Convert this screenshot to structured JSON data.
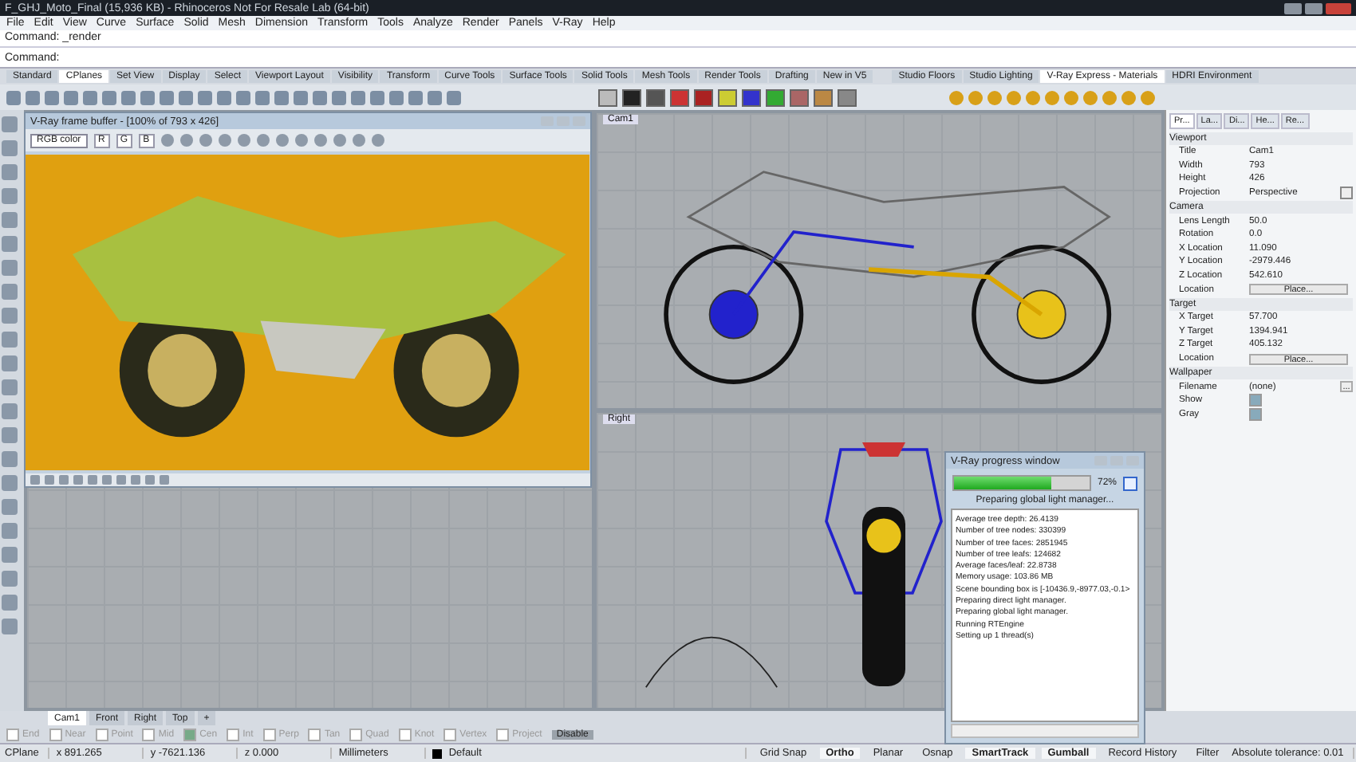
{
  "window": {
    "title": "F_GHJ_Moto_Final (15,936 KB) - Rhinoceros Not For Resale Lab (64-bit)"
  },
  "menu": [
    "File",
    "Edit",
    "View",
    "Curve",
    "Surface",
    "Solid",
    "Mesh",
    "Dimension",
    "Transform",
    "Tools",
    "Analyze",
    "Render",
    "Panels",
    "V-Ray",
    "Help"
  ],
  "command": {
    "history": "Command: _render",
    "prompt": "Command:"
  },
  "toolbar_tabs": [
    {
      "label": "Standard",
      "selected": false
    },
    {
      "label": "CPlanes",
      "selected": true
    },
    {
      "label": "Set View",
      "selected": false
    },
    {
      "label": "Display",
      "selected": false
    },
    {
      "label": "Select",
      "selected": false
    },
    {
      "label": "Viewport Layout",
      "selected": false
    },
    {
      "label": "Visibility",
      "selected": false
    },
    {
      "label": "Transform",
      "selected": false
    },
    {
      "label": "Curve Tools",
      "selected": false
    },
    {
      "label": "Surface Tools",
      "selected": false
    },
    {
      "label": "Solid Tools",
      "selected": false
    },
    {
      "label": "Mesh Tools",
      "selected": false
    },
    {
      "label": "Render Tools",
      "selected": false
    },
    {
      "label": "Drafting",
      "selected": false
    },
    {
      "label": "New in V5",
      "selected": false
    }
  ],
  "vray_tabs": [
    {
      "label": "Studio Floors",
      "selected": false
    },
    {
      "label": "Studio Lighting",
      "selected": false
    },
    {
      "label": "V-Ray Express - Materials",
      "selected": true
    },
    {
      "label": "HDRI Environment",
      "selected": false
    }
  ],
  "viewports": [
    {
      "label": "Cam1"
    },
    {
      "label": "Right"
    }
  ],
  "frame_buffer": {
    "title": "V-Ray frame buffer - [100% of 793 x 426]",
    "channel": "RGB color",
    "channels": [
      "R",
      "G",
      "B"
    ]
  },
  "progress": {
    "title": "V-Ray progress window",
    "level": 0.72,
    "percent": "72%",
    "status": "Preparing global light manager...",
    "log": [
      "Average tree depth: 26.4139",
      "Number of tree nodes: 330399",
      "Number of tree faces: 2851945",
      "Number of tree leafs: 124682",
      "Average faces/leaf: 22.8738",
      "Memory usage: 103.86 MB",
      "Scene bounding box is [-10436.9,-8977.03,-0.1>",
      "Preparing direct light manager.",
      "Preparing global light manager.",
      "Running RTEngine",
      "Setting up 1 thread(s)"
    ]
  },
  "panel": {
    "tabs": [
      {
        "label": "Pr...",
        "selected": true
      },
      {
        "label": "La...",
        "selected": false
      },
      {
        "label": "Di...",
        "selected": false
      },
      {
        "label": "He...",
        "selected": false
      },
      {
        "label": "Re...",
        "selected": false
      }
    ],
    "sections": [
      {
        "title": "Viewport",
        "rows": [
          {
            "kind": "text",
            "label": "Title",
            "value": "Cam1"
          },
          {
            "kind": "text",
            "label": "Width",
            "value": "793"
          },
          {
            "kind": "text",
            "label": "Height",
            "value": "426"
          },
          {
            "kind": "dropdown",
            "label": "Projection",
            "value": "Perspective"
          }
        ]
      },
      {
        "title": "Camera",
        "rows": [
          {
            "kind": "text",
            "label": "Lens Length",
            "value": "50.0"
          },
          {
            "kind": "text",
            "label": "Rotation",
            "value": "0.0"
          },
          {
            "kind": "text",
            "label": "X Location",
            "value": "11.090"
          },
          {
            "kind": "text",
            "label": "Y Location",
            "value": "-2979.446"
          },
          {
            "kind": "text",
            "label": "Z Location",
            "value": "542.610"
          },
          {
            "kind": "button",
            "label": "Location",
            "value": "Place..."
          }
        ]
      },
      {
        "title": "Target",
        "rows": [
          {
            "kind": "text",
            "label": "X Target",
            "value": "57.700"
          },
          {
            "kind": "text",
            "label": "Y Target",
            "value": "1394.941"
          },
          {
            "kind": "text",
            "label": "Z Target",
            "value": "405.132"
          },
          {
            "kind": "button",
            "label": "Location",
            "value": "Place..."
          }
        ]
      },
      {
        "title": "Wallpaper",
        "rows": [
          {
            "kind": "file",
            "label": "Filename",
            "value": "(none)",
            "button": "..."
          },
          {
            "kind": "check",
            "label": "Show",
            "checked": true
          },
          {
            "kind": "check",
            "label": "Gray",
            "checked": true
          }
        ]
      }
    ]
  },
  "view_tabs": [
    {
      "label": "Cam1",
      "selected": true
    },
    {
      "label": "Front",
      "selected": false
    },
    {
      "label": "Right",
      "selected": false
    },
    {
      "label": "Top",
      "selected": false
    },
    {
      "label": "+",
      "selected": false
    }
  ],
  "osnaps": [
    {
      "label": "End",
      "checked": false
    },
    {
      "label": "Near",
      "checked": false
    },
    {
      "label": "Point",
      "checked": false
    },
    {
      "label": "Mid",
      "checked": false
    },
    {
      "label": "Cen",
      "checked": true
    },
    {
      "label": "Int",
      "checked": false
    },
    {
      "label": "Perp",
      "checked": false
    },
    {
      "label": "Tan",
      "checked": false
    },
    {
      "label": "Quad",
      "checked": false
    },
    {
      "label": "Knot",
      "checked": false
    },
    {
      "label": "Vertex",
      "checked": false
    },
    {
      "label": "Project",
      "checked": false
    }
  ],
  "osnap_disable": "Disable",
  "status_bar": {
    "cplane": "CPlane",
    "x": "x 891.265",
    "y": "y -7621.136",
    "z": "z 0.000",
    "units": "Millimeters",
    "layer": "Default",
    "toggles": [
      {
        "label": "Grid Snap",
        "on": false
      },
      {
        "label": "Ortho",
        "on": true
      },
      {
        "label": "Planar",
        "on": false
      },
      {
        "label": "Osnap",
        "on": false
      },
      {
        "label": "SmartTrack",
        "on": true
      },
      {
        "label": "Gumball",
        "on": true
      },
      {
        "label": "Record History",
        "on": false
      },
      {
        "label": "Filter",
        "on": false
      }
    ],
    "tolerance": "Absolute tolerance: 0.01"
  }
}
